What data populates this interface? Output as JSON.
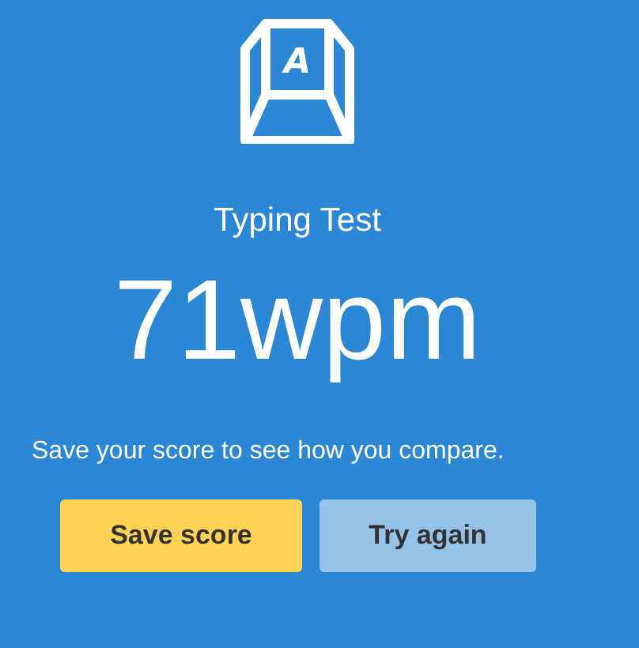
{
  "icon_letter": "A",
  "title": "Typing Test",
  "score": "71wpm",
  "message": "Save your score to see how you compare.",
  "buttons": [
    {
      "label": "Save score",
      "kind": "primary"
    },
    {
      "label": "Try again",
      "kind": "secondary"
    }
  ]
}
